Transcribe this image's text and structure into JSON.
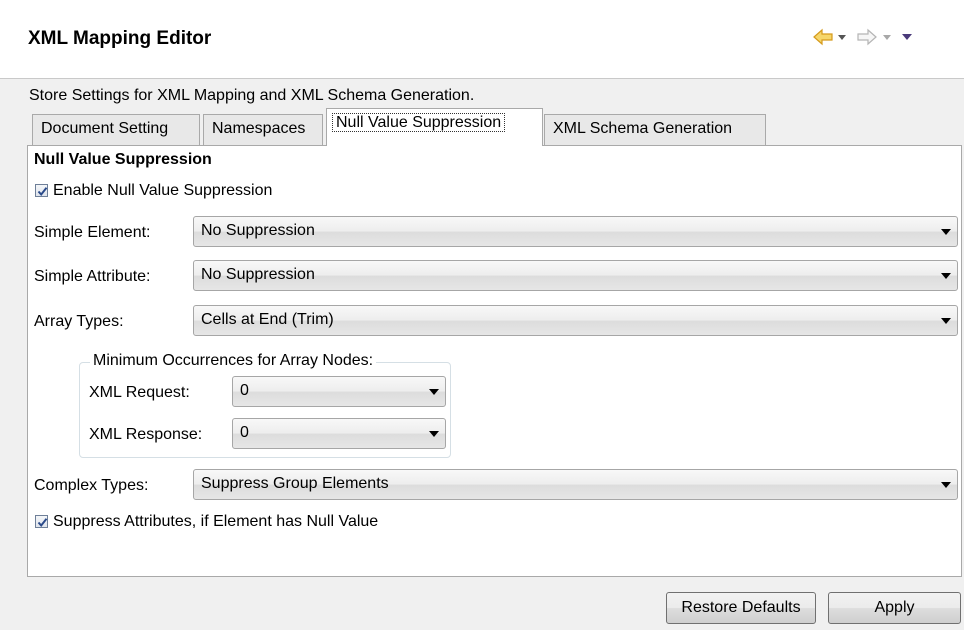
{
  "header": {
    "title": "XML Mapping Editor",
    "nav_icons": [
      "back-arrow-icon",
      "back-dropdown-icon",
      "forward-arrow-icon",
      "forward-dropdown-icon",
      "view-menu-icon"
    ]
  },
  "description": "Store Settings for XML Mapping and XML Schema Generation.",
  "tabs": [
    {
      "label": "Document Setting"
    },
    {
      "label": "Namespaces"
    },
    {
      "label": "Null Value Suppression",
      "selected": true
    },
    {
      "label": "XML Schema Generation"
    }
  ],
  "panel": {
    "section_title": "Null Value Suppression",
    "enable_suppression": {
      "label": "Enable Null Value Suppression",
      "checked": true
    },
    "simple_element": {
      "label": "Simple Element:",
      "value": "No Suppression"
    },
    "simple_attribute": {
      "label": "Simple Attribute:",
      "value": "No Suppression"
    },
    "array_types": {
      "label": "Array Types:",
      "value": "Cells at End (Trim)"
    },
    "min_occurrences": {
      "title": "Minimum Occurrences for Array Nodes:",
      "xml_request": {
        "label": "XML Request:",
        "value": "0"
      },
      "xml_response": {
        "label": "XML Response:",
        "value": "0"
      }
    },
    "complex_types": {
      "label": "Complex Types:",
      "value": "Suppress Group Elements"
    },
    "suppress_attributes": {
      "label": "Suppress Attributes, if Element has Null Value",
      "checked": true
    }
  },
  "buttons": {
    "restore_defaults": "Restore Defaults",
    "apply": "Apply"
  },
  "colors": {
    "nav_back": "#e8b030",
    "nav_forward": "#c0c0c0",
    "view_menu": "#4a3a7a",
    "checkmark": "#2a4a8a"
  }
}
